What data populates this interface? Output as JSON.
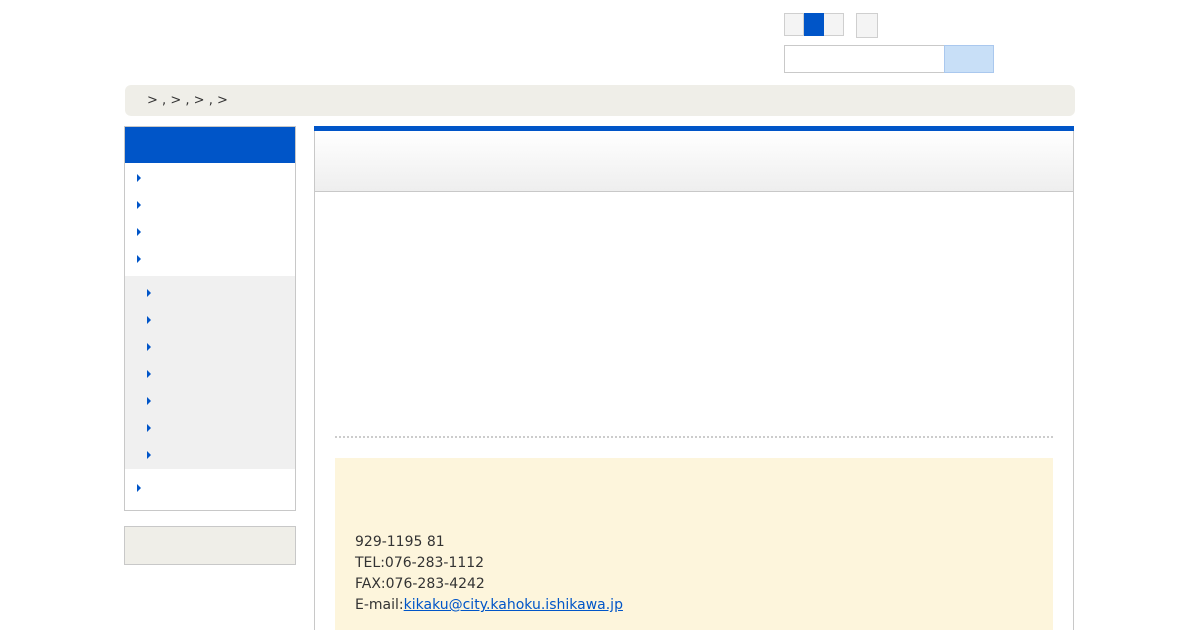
{
  "header": {
    "font_size_buttons": [
      "",
      "",
      ""
    ],
    "font_size_active_index": 1,
    "search": {
      "value": "",
      "placeholder": ""
    }
  },
  "breadcrumb": {
    "separators": [
      ">",
      ",",
      ">",
      ",",
      ">",
      ",",
      ">"
    ]
  },
  "sidebar": {
    "items": [
      "",
      "",
      "",
      ""
    ],
    "sub_items": [
      "",
      "",
      "",
      "",
      "",
      "",
      ""
    ],
    "last_item": ""
  },
  "contact": {
    "postal": "929-1195 81",
    "tel": "TEL:076-283-1112",
    "fax": "FAX:076-283-4242",
    "email_label": "E-mail:",
    "email": "kikaku@city.kahoku.ishikawa.jp"
  },
  "colors": {
    "accent": "#0055c8",
    "breadcrumb_bg": "#efeee8",
    "contact_bg": "#fdf5dc"
  }
}
